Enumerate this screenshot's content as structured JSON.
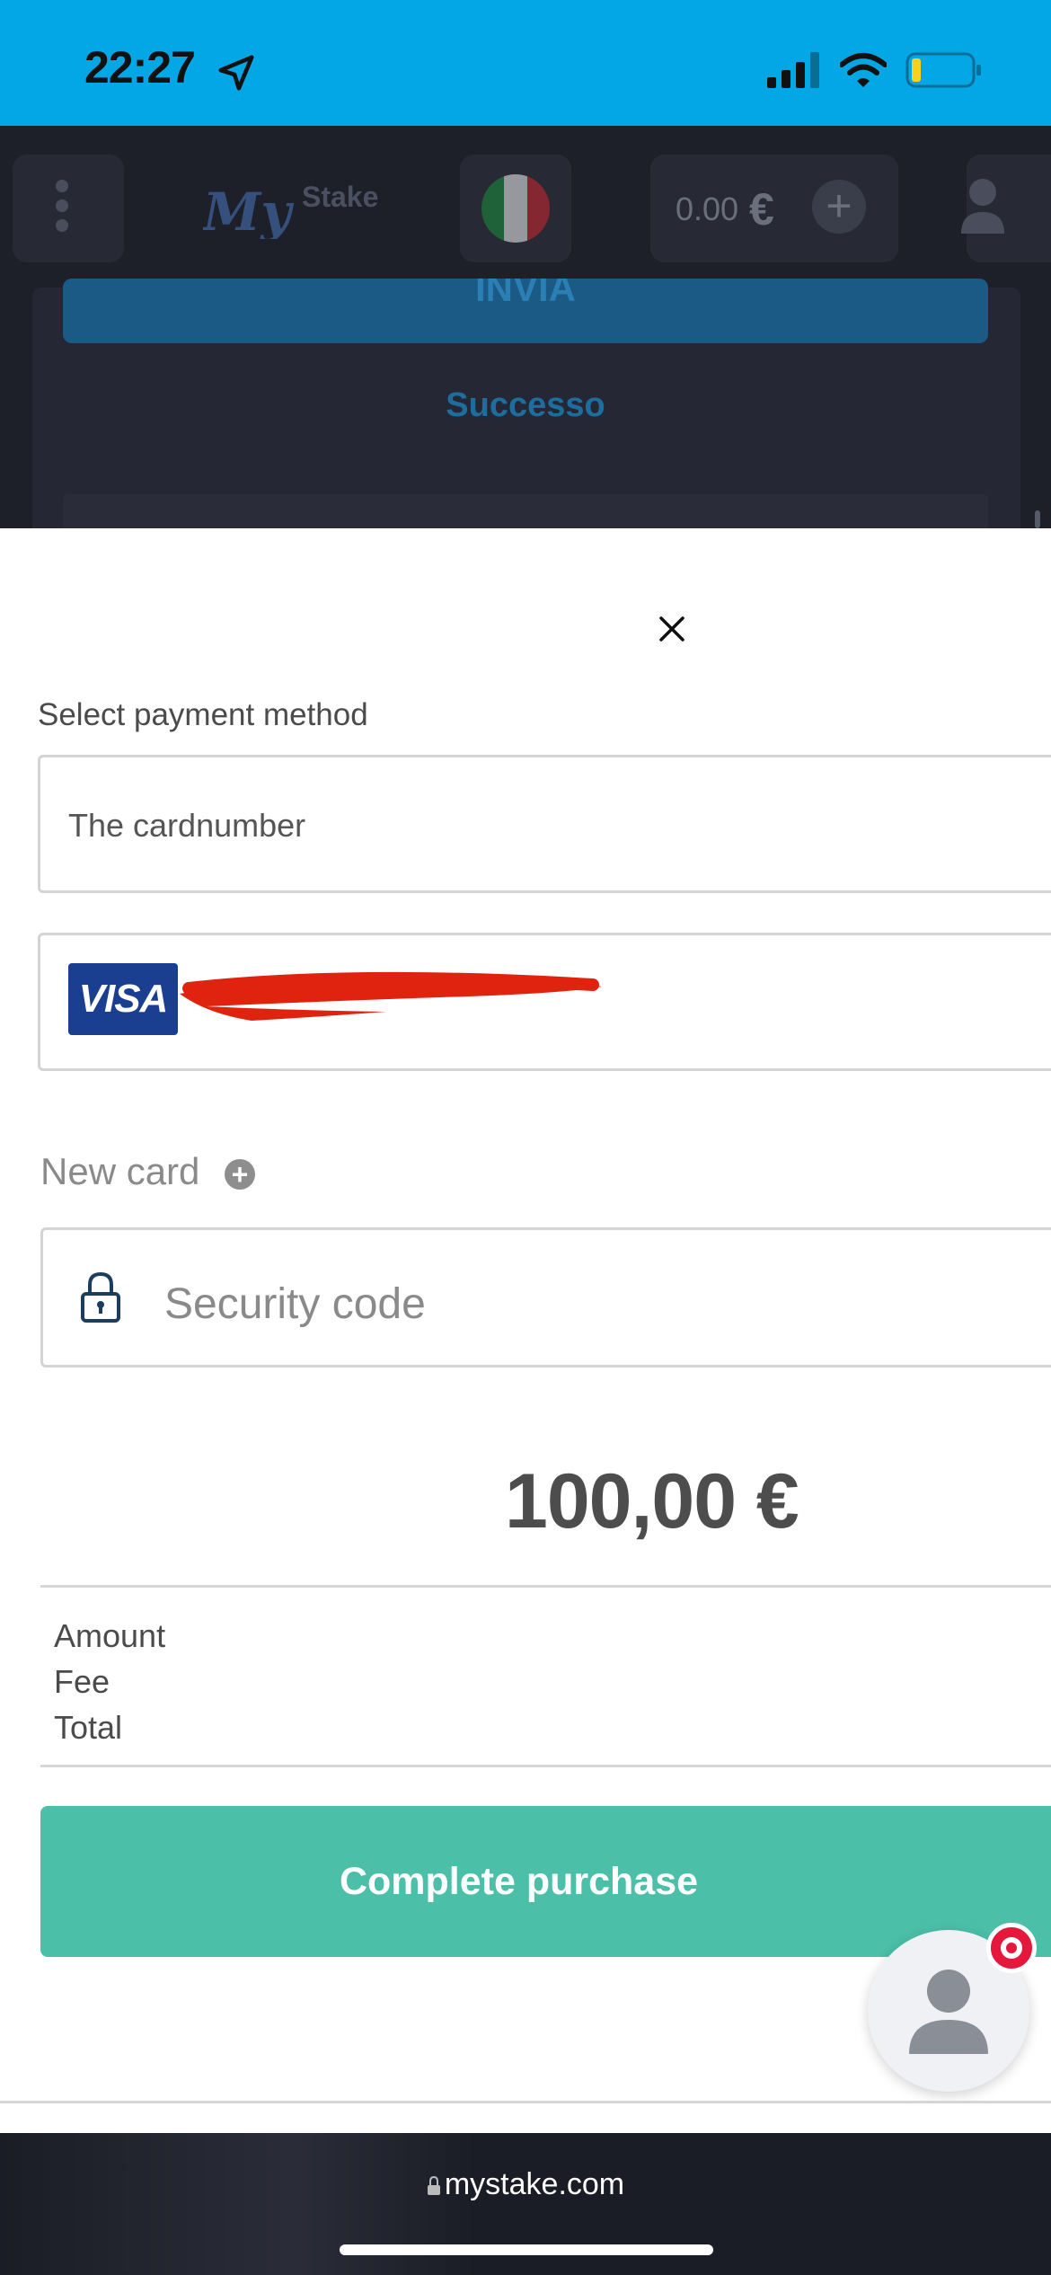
{
  "status_bar": {
    "time": "22:27"
  },
  "site_header": {
    "brand_logo": "MyStake",
    "balance": "0.00",
    "currency_icon": "€",
    "plus_icon": "+"
  },
  "background_page": {
    "submit_button": "INVIA",
    "status_text": "Successo"
  },
  "payment": {
    "section_label": "Select payment method",
    "card_number_placeholder": "The cardnumber",
    "saved_card_brand": "VISA",
    "new_card_label": "New card",
    "security_code_placeholder": "Security code",
    "amount_display": "100,00 €",
    "breakdown": [
      "Amount",
      "Fee",
      "Total"
    ],
    "submit_label": "Complete purchase"
  },
  "browser": {
    "url": "mystake.com"
  },
  "colors": {
    "status_bar": "#04a7e6",
    "site_bg": "#1e2029",
    "submit_button": "#4bbfa8",
    "visa_blue": "#1a3f91",
    "chat_badge": "#e6173d"
  }
}
